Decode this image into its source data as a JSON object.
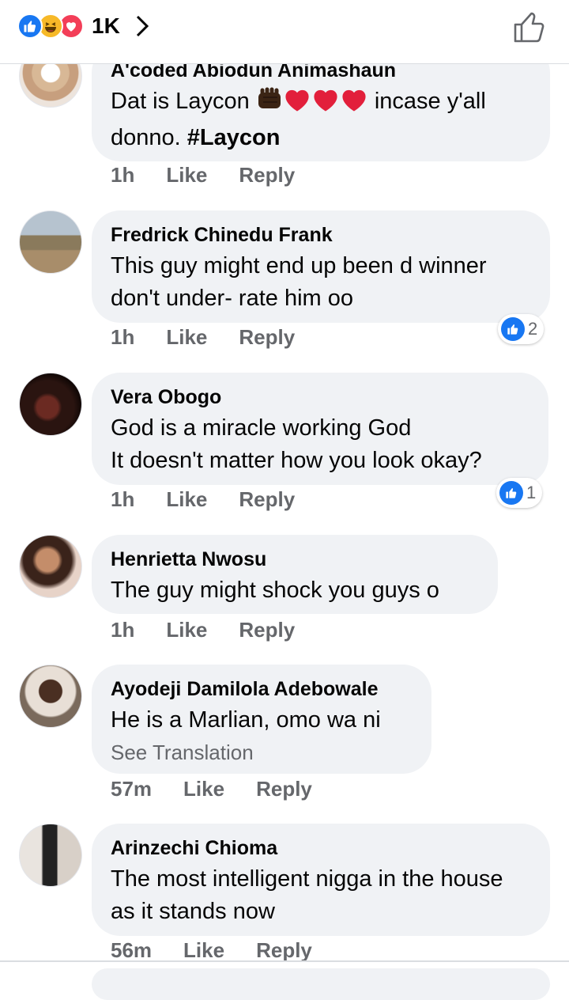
{
  "reactions": {
    "count": "1K",
    "types": [
      "like-icon",
      "haha-icon",
      "love-icon"
    ]
  },
  "colors": {
    "accent": "#1877f2",
    "bubble": "#f0f2f5",
    "meta": "#65676b",
    "love": "#f33e58",
    "haha": "#f7b928"
  },
  "comments": [
    {
      "author": "A'coded Abiodun Animashaun",
      "text_before": "Dat is Laycon",
      "text_after": "incase y'all donno.",
      "hashtag": "#Laycon",
      "time": "1h",
      "like": "Like",
      "reply": "Reply"
    },
    {
      "author": "Fredrick Chinedu Frank",
      "text": "This guy might end up been d winner don't under- rate him oo",
      "time": "1h",
      "like": "Like",
      "reply": "Reply",
      "reaction_count": "2"
    },
    {
      "author": "Vera Obogo",
      "line1": "God is a miracle working God",
      "line2": "It doesn't matter how you look okay?",
      "time": "1h",
      "like": "Like",
      "reply": "Reply",
      "reaction_count": "1"
    },
    {
      "author": "Henrietta Nwosu",
      "text": "The guy might shock you guys o",
      "time": "1h",
      "like": "Like",
      "reply": "Reply"
    },
    {
      "author": "Ayodeji Damilola Adebowale",
      "text": "He is a Marlian, omo wa ni",
      "see_translation": "See Translation",
      "time": "57m",
      "like": "Like",
      "reply": "Reply"
    },
    {
      "author": "Arinzechi Chioma",
      "text": "The most intelligent nigga in the house as it stands now",
      "time": "56m",
      "like": "Like",
      "reply": "Reply"
    }
  ]
}
